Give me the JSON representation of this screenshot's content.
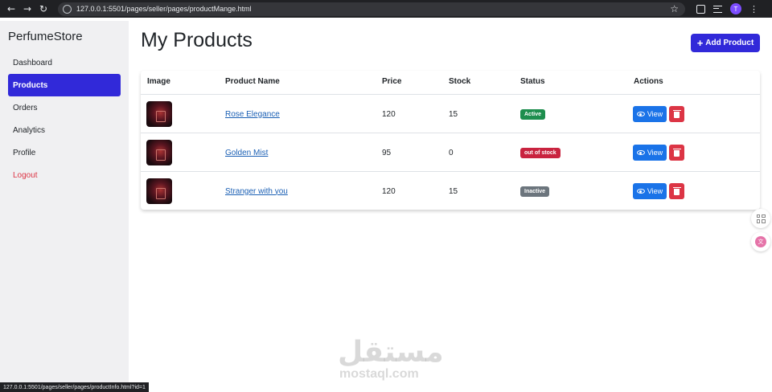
{
  "browser": {
    "url": "127.0.0.1:5501/pages/seller/pages/productMange.html",
    "profile_initial": "T",
    "back_icon": "arrow-left-icon",
    "forward_icon": "arrow-right-icon",
    "reload_icon": "reload-icon",
    "back_glyph": "←",
    "forward_glyph": "→",
    "reload_glyph": "↻",
    "star_glyph": "☆",
    "menu_glyph": "⋮"
  },
  "sidebar": {
    "brand": "PerfumeStore",
    "items": [
      {
        "label": "Dashboard"
      },
      {
        "label": "Products",
        "active": true
      },
      {
        "label": "Orders"
      },
      {
        "label": "Analytics"
      },
      {
        "label": "Profile"
      },
      {
        "label": "Logout",
        "color": "#dc3545"
      }
    ]
  },
  "main": {
    "title": "My Products",
    "add_button": {
      "label": "Add Product",
      "icon": "plus-icon",
      "glyph": "+"
    },
    "table": {
      "headers": [
        "Image",
        "Product Name",
        "Price",
        "Stock",
        "Status",
        "Actions"
      ],
      "rows": [
        {
          "name": "Rose Elegance",
          "price": "120",
          "stock": "15",
          "status": "Active",
          "status_color": "#1e8e4e",
          "view_label": "View"
        },
        {
          "name": "Golden Mist",
          "price": "95",
          "stock": "0",
          "status": "out of stock",
          "status_color": "#c9233f",
          "view_label": "View"
        },
        {
          "name": "Stranger with you",
          "price": "120",
          "stock": "15",
          "status": "Inactive",
          "status_color": "#6c757d",
          "view_label": "View"
        }
      ]
    }
  },
  "status_bar": {
    "text": "127.0.0.1:5501/pages/seller/pages/productInfo.html?id=1"
  },
  "watermark": {
    "arabic": "مستقل",
    "latin": "mostaql.com"
  },
  "colors": {
    "accent": "#3129d9",
    "view_button": "#1a73e8",
    "delete_button": "#dc3545",
    "link": "#1a5fb4"
  }
}
